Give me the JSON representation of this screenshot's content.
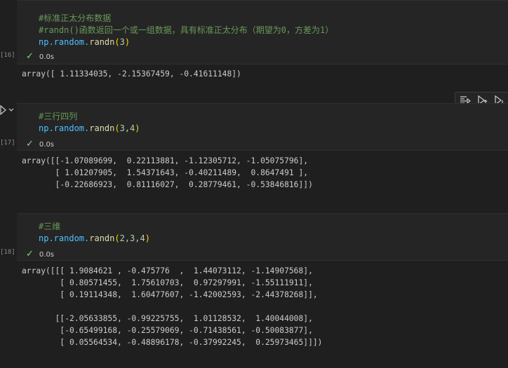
{
  "cells": [
    {
      "exec_count": "[16]",
      "lines": [
        "#标准正太分布数据",
        "#randn()函数返回一个或一组数据，具有标准正太分布（期望为0，方差为1）"
      ],
      "code": {
        "module": "np.random.",
        "func": "randn",
        "open": "(",
        "args": "3",
        "close": ")"
      },
      "status": "0.0s",
      "output": [
        "array([ 1.11334035, -2.15367459, -0.41611148])"
      ]
    },
    {
      "exec_count": "[17]",
      "lines": [
        "#三行四列"
      ],
      "code": {
        "module": "np.random.",
        "func": "randn",
        "open": "(",
        "args": "3,4",
        "close": ")"
      },
      "status": "0.0s",
      "output": [
        "array([[-1.07089699,  0.22113881, -1.12305712, -1.05075796],",
        "       [ 1.01207905,  1.54371643, -0.40211489,  0.8647491 ],",
        "       [-0.22686923,  0.81116027,  0.28779461, -0.53846816]])"
      ]
    },
    {
      "exec_count": "[18]",
      "lines": [
        "#三维"
      ],
      "code": {
        "module": "np.random.",
        "func": "randn",
        "open": "(",
        "args": "2,3,4",
        "close": ")"
      },
      "status": "0.0s",
      "output": [
        "array([[[ 1.9084621 , -0.475776  ,  1.44073112, -1.14907568],",
        "        [ 0.80571455,  1.75610703,  0.97297991, -1.55111911],",
        "        [ 0.19114348,  1.60477607, -1.42002593, -2.44378268]],",
        "",
        "       [[-2.05633855, -0.99225755,  1.01128532,  1.40044008],",
        "        [-0.65499168, -0.25579069, -0.71438561, -0.50083877],",
        "        [ 0.05564534, -0.48896178, -0.37992245,  0.25973465]]])"
      ]
    }
  ],
  "toolbar": {
    "icons": [
      "run-by-line-icon",
      "execute-above-icon",
      "execute-below-icon"
    ]
  },
  "check_glyph": "✓"
}
